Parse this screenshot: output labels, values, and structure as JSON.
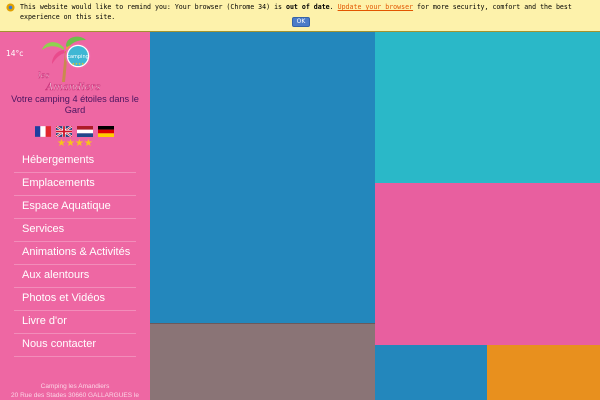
{
  "notice": {
    "text_before": "This website would like to remind you: Your browser (Chrome 34) is ",
    "bold": "out of date",
    "text_mid": ". ",
    "link": "Update your browser",
    "text_after": " for more security, comfort and the best experience on this site.",
    "ok_label": "OK"
  },
  "sidebar": {
    "temperature": "14°c",
    "logo_text_small": "camping",
    "logo_text_les": "les",
    "logo_text_name": "Amandiers",
    "tagline": "Votre camping 4 étoiles dans le Gard",
    "stars": "★★★★",
    "flags": [
      "fr",
      "en",
      "nl",
      "de"
    ],
    "menu": [
      "Hébergements",
      "Emplacements",
      "Espace Aquatique",
      "Services",
      "Animations & Activités",
      "Aux alentours",
      "Photos et Vidéos",
      "Livre d'or",
      "Nous contacter"
    ],
    "address_line1": "Camping les Amandiers",
    "address_line2": "20 Rue des Stades 30660 GALLARGUES le"
  },
  "colors": {
    "sidebar": "#ee67a3",
    "blue": "#2387bc",
    "teal": "#2ab8c8",
    "pink": "#e85f9f",
    "taupe": "#8a7476",
    "orange": "#e8901e",
    "banner": "#fdf2ab"
  }
}
